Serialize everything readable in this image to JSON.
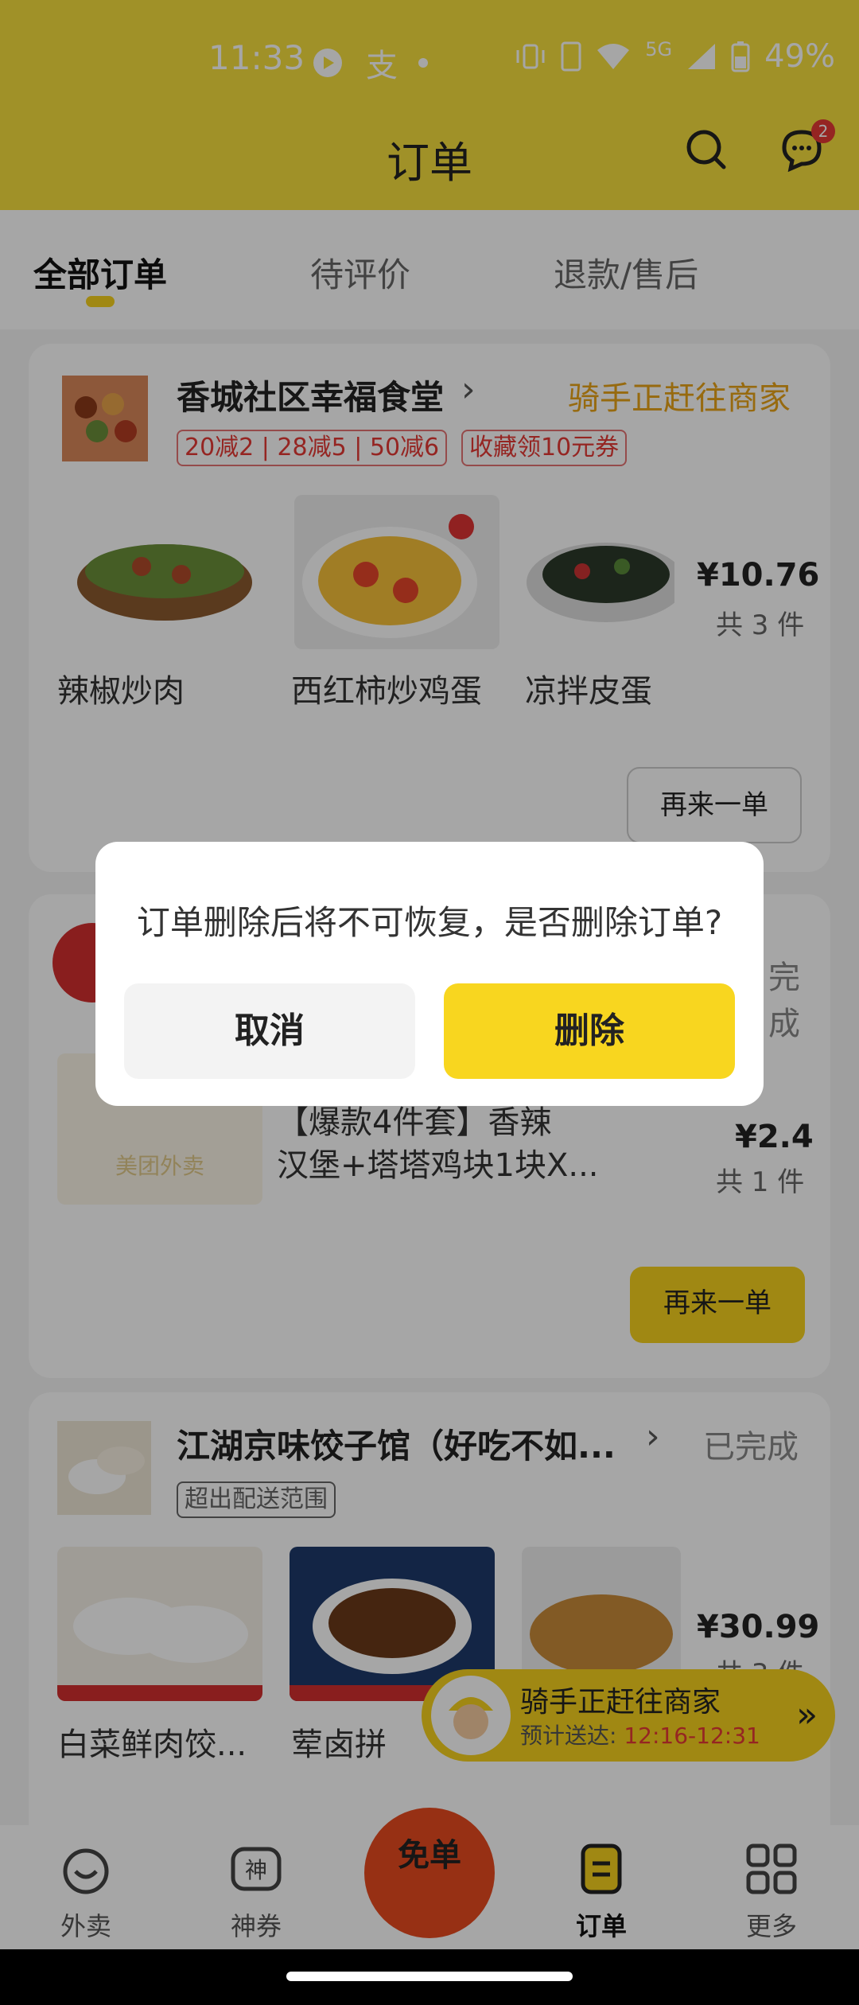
{
  "status_bar": {
    "time": "11:33",
    "battery": "49%",
    "network": "5G"
  },
  "header": {
    "title": "订单",
    "chat_badge": "2"
  },
  "tabs": [
    {
      "label": "全部订单"
    },
    {
      "label": "待评价"
    },
    {
      "label": "退款/售后"
    }
  ],
  "orders": [
    {
      "store_name": "香城社区幸福食堂",
      "status": "骑手正赶往商家",
      "promos": [
        "20减2 | 28减5 | 50减6",
        "收藏领10元券"
      ],
      "items": [
        "辣椒炒肉",
        "西红柿炒鸡蛋",
        "凉拌皮蛋"
      ],
      "price": "¥10.76",
      "qty": "共 3 件",
      "action": "再来一单"
    },
    {
      "store_name": "",
      "status": "完成",
      "item_desc_line1": "【爆款4件套】香辣",
      "item_desc_line2": "汉堡+塔塔鸡块1块X...",
      "price": "¥2.4",
      "qty": "共 1 件",
      "action": "再来一单",
      "placeholder_brand": "美团外卖"
    },
    {
      "store_name": "江湖京味饺子馆（好吃不如...",
      "status": "已完成",
      "tag": "超出配送范围",
      "items": [
        "白菜鲜肉饺...",
        "荤卤拼"
      ],
      "price": "¥30.99",
      "qty": "共 3 件"
    }
  ],
  "rider_float": {
    "line1": "骑手正赶往商家",
    "line2_prefix": "预计送达:",
    "line2_time": "12:16-12:31"
  },
  "bottom_nav": [
    {
      "label": "外卖",
      "icon": "takeout-icon"
    },
    {
      "label": "神券",
      "icon": "coupon-icon"
    },
    {
      "label": "订单",
      "icon": "order-icon"
    },
    {
      "label": "更多",
      "icon": "more-icon"
    }
  ],
  "free_btn": "免单",
  "dialog": {
    "message": "订单删除后将不可恢复，是否删除订单?",
    "cancel": "取消",
    "delete": "删除"
  }
}
